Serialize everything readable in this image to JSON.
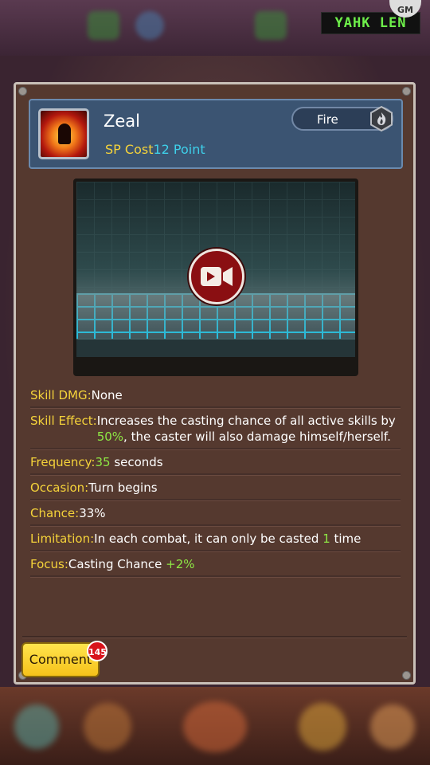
{
  "watermark": "YAHK LEN",
  "corner_badge": "GM",
  "skill": {
    "name": "Zeal",
    "sp_label": "SP Cost",
    "sp_value": "12 Point",
    "element": "Fire",
    "element_icon": "flame-icon",
    "icon": "zeal-skill-icon"
  },
  "video": {
    "play_icon": "video-camera-icon"
  },
  "details": [
    {
      "key": "Skill DMG:",
      "parts": [
        "None"
      ]
    },
    {
      "key": "Skill Effect:",
      "parts": [
        "Increases the casting chance of all active skills by ",
        "50%",
        ", the caster will also damage himself/herself."
      ]
    },
    {
      "key": "Frequency:",
      "parts": [
        "35",
        " seconds"
      ]
    },
    {
      "key": "Occasion:",
      "parts": [
        "Turn begins"
      ]
    },
    {
      "key": "Chance:",
      "parts": [
        "33%"
      ]
    },
    {
      "key": "Limitation:",
      "parts": [
        "In each combat, it can only be casted ",
        "1",
        " time"
      ]
    },
    {
      "key": "Focus:",
      "parts": [
        "Casting Chance ",
        "+2%"
      ]
    }
  ],
  "comment": {
    "label": "Comment",
    "count": "145"
  },
  "colors": {
    "panel": "#55392f",
    "header": "#3b5472",
    "label_yellow": "#f5d33a",
    "value_cyan": "#3ed0ea",
    "highlight_green": "#8ee845",
    "comment_button": "#f6c21a",
    "badge_red": "#d8141c"
  }
}
